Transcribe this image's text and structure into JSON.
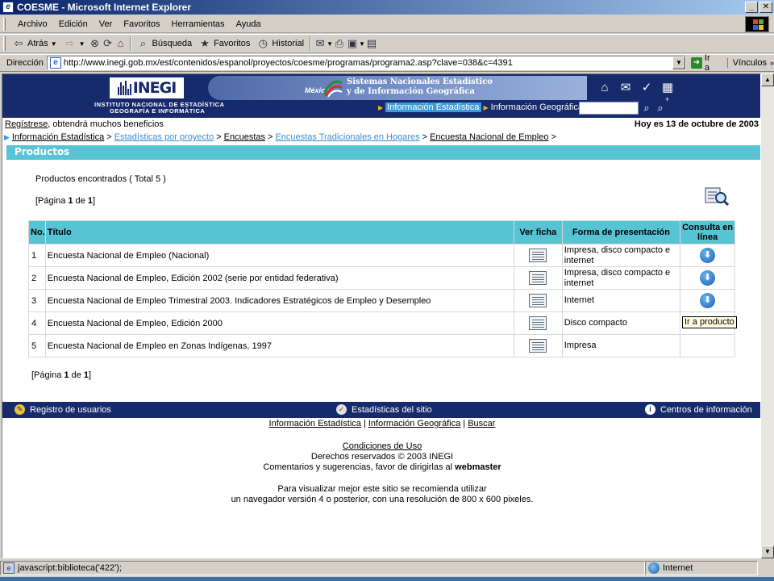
{
  "window": {
    "title": "COESME - Microsoft Internet Explorer"
  },
  "menu": [
    "Archivo",
    "Edición",
    "Ver",
    "Favoritos",
    "Herramientas",
    "Ayuda"
  ],
  "toolbar": {
    "back": "Atrás",
    "search": "Búsqueda",
    "favorites": "Favoritos",
    "history": "Historial"
  },
  "address": {
    "label": "Dirección",
    "url": "http://www.inegi.gob.mx/est/contenidos/espanol/proyectos/coesme/programas/programa2.asp?clave=038&c=4391",
    "go": "Ir a",
    "links": "Vínculos"
  },
  "header": {
    "logo": "INEGI",
    "institute_line1": "INSTITUTO NACIONAL DE ESTADÍSTICA",
    "institute_line2": "GEOGRAFÍA E INFORMÁTICA",
    "banner_country": "México",
    "banner_line1": "Sistemas Nacionales Estadístico",
    "banner_line2": "y de Información Geográfica",
    "nav_stats": "Información Estadística",
    "nav_geo": "Información Geográfica"
  },
  "register": {
    "link": "Regístrese",
    "rest": ", obtendrá muchos beneficios"
  },
  "date_text": "Hoy es 13 de octubre de 2003",
  "breadcrumb": [
    "Información Estadística",
    "Estadísticas por proyecto",
    "Encuestas",
    "Encuestas Tradicionales en Hogares",
    "Encuesta Nacional de Empleo"
  ],
  "section_title": "Productos",
  "found_text": "Productos encontrados ( Total 5 )",
  "pager": {
    "prefix": "[Página ",
    "page": "1",
    "middle": " de ",
    "total": "1",
    "suffix": "]"
  },
  "table": {
    "headers": {
      "num": "No.",
      "title": "Título",
      "ficha": "Ver ficha",
      "forma": "Forma de presentación",
      "consulta": "Consulta en línea"
    },
    "rows": [
      {
        "num": "1",
        "title": "Encuesta Nacional de Empleo (Nacional)",
        "forma": "Impresa, disco compacto e internet",
        "online": true
      },
      {
        "num": "2",
        "title": "Encuesta Nacional de Empleo, Edición 2002 (serie por entidad federativa)",
        "forma": "Impresa, disco compacto e internet",
        "online": true
      },
      {
        "num": "3",
        "title": "Encuesta Nacional de Empleo Trimestral 2003. Indicadores Estratégicos de Empleo y Desempleo",
        "forma": "Internet",
        "online": true
      },
      {
        "num": "4",
        "title": "Encuesta Nacional de Empleo, Edición 2000",
        "forma": "Disco compacto",
        "online": false
      },
      {
        "num": "5",
        "title": "Encuesta Nacional de Empleo en Zonas Indígenas, 1997",
        "forma": "Impresa",
        "online": false
      }
    ]
  },
  "tooltip": "Ir a producto",
  "footer": {
    "registro": "Registro de usuarios",
    "estadisticas": "Estadísticas del sitio",
    "centros": "Centros de información",
    "link_stats": "Información Estadística",
    "link_geo": "Información Geográfica",
    "link_search": "Buscar",
    "conditions": "Condiciones de Uso",
    "copyright": "Derechos reservados © 2003 INEGI",
    "comments_prefix": "Comentarios y sugerencias, favor de dirigirlas al ",
    "webmaster": "webmaster",
    "recommend1": "Para visualizar mejor este sitio se recomienda utilizar",
    "recommend2": "un navegador versión 4 o posterior, con una resolución de 800 x 600 pixeles."
  },
  "status": {
    "text": "javascript:biblioteca('422');",
    "zone": "Internet"
  },
  "colors": {
    "navy": "#162a6c",
    "teal": "#56c4d4",
    "link_light": "#3b8fcf"
  }
}
